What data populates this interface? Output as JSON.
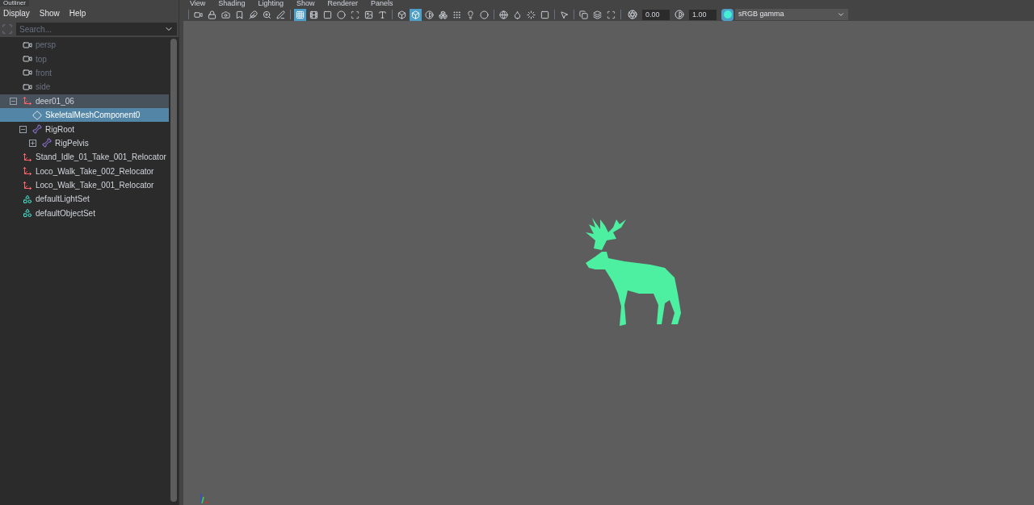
{
  "outliner": {
    "tab": "Outliner",
    "menu": [
      "Display",
      "Show",
      "Help"
    ],
    "search": {
      "placeholder": "Search..."
    },
    "items": [
      {
        "label": "persp",
        "kind": "camera",
        "dimmed": true,
        "selected": false
      },
      {
        "label": "top",
        "kind": "camera",
        "dimmed": true,
        "selected": false
      },
      {
        "label": "front",
        "kind": "camera",
        "dimmed": true,
        "selected": false
      },
      {
        "label": "side",
        "kind": "camera",
        "dimmed": true,
        "selected": false
      },
      {
        "label": "deer01_06",
        "kind": "transform",
        "dimmed": false,
        "selected": false,
        "highlighted": true,
        "expanded": true,
        "children": [
          {
            "label": "SkeletalMeshComponent0",
            "kind": "mesh",
            "dimmed": false,
            "selected": true
          },
          {
            "label": "RigRoot",
            "kind": "joint",
            "dimmed": false,
            "selected": false,
            "expanded": true,
            "children": [
              {
                "label": "RigPelvis",
                "kind": "joint",
                "dimmed": false,
                "selected": false,
                "expanded": false
              }
            ]
          }
        ]
      },
      {
        "label": "Stand_Idle_01_Take_001_Relocator",
        "kind": "transform",
        "dimmed": false,
        "selected": false
      },
      {
        "label": "Loco_Walk_Take_002_Relocator",
        "kind": "transform",
        "dimmed": false,
        "selected": false
      },
      {
        "label": "Loco_Walk_Take_001_Relocator",
        "kind": "transform",
        "dimmed": false,
        "selected": false
      },
      {
        "label": "defaultLightSet",
        "kind": "set",
        "dimmed": false,
        "selected": false
      },
      {
        "label": "defaultObjectSet",
        "kind": "set",
        "dimmed": false,
        "selected": false
      }
    ]
  },
  "viewport": {
    "menu": [
      "View",
      "Shading",
      "Lighting",
      "Show",
      "Renderer",
      "Panels"
    ],
    "toolbar": [
      [
        {
          "kind": "camera",
          "on": false
        },
        {
          "kind": "lock",
          "on": false
        },
        {
          "kind": "video",
          "on": false
        },
        {
          "kind": "bookmark",
          "on": false
        },
        {
          "kind": "feather",
          "on": false
        },
        {
          "kind": "zoom",
          "on": false
        },
        {
          "kind": "pen",
          "on": false
        }
      ],
      [
        {
          "kind": "grid",
          "on": true
        },
        {
          "kind": "film",
          "on": false
        },
        {
          "kind": "square",
          "on": false
        },
        {
          "kind": "circle",
          "on": false
        },
        {
          "kind": "scan",
          "on": false
        },
        {
          "kind": "image",
          "on": false
        },
        {
          "kind": "type",
          "on": false
        }
      ],
      [
        {
          "kind": "box",
          "on": false
        },
        {
          "kind": "cube",
          "on": true
        },
        {
          "kind": "contrast",
          "on": false
        },
        {
          "kind": "boxes",
          "on": false
        },
        {
          "kind": "dots",
          "on": false
        },
        {
          "kind": "bulb",
          "on": false
        },
        {
          "kind": "circle",
          "on": false
        }
      ],
      [
        {
          "kind": "sphere",
          "on": false
        },
        {
          "kind": "droplet",
          "on": false
        },
        {
          "kind": "loader",
          "on": false
        },
        {
          "kind": "square",
          "on": false
        }
      ],
      [
        {
          "kind": "pointer",
          "on": false
        }
      ],
      [
        {
          "kind": "copy",
          "on": false
        },
        {
          "kind": "layers",
          "on": false
        },
        {
          "kind": "scan",
          "on": false
        }
      ]
    ],
    "exposure": "0.00",
    "gamma": "1.00",
    "color_space": "sRGB gamma"
  }
}
